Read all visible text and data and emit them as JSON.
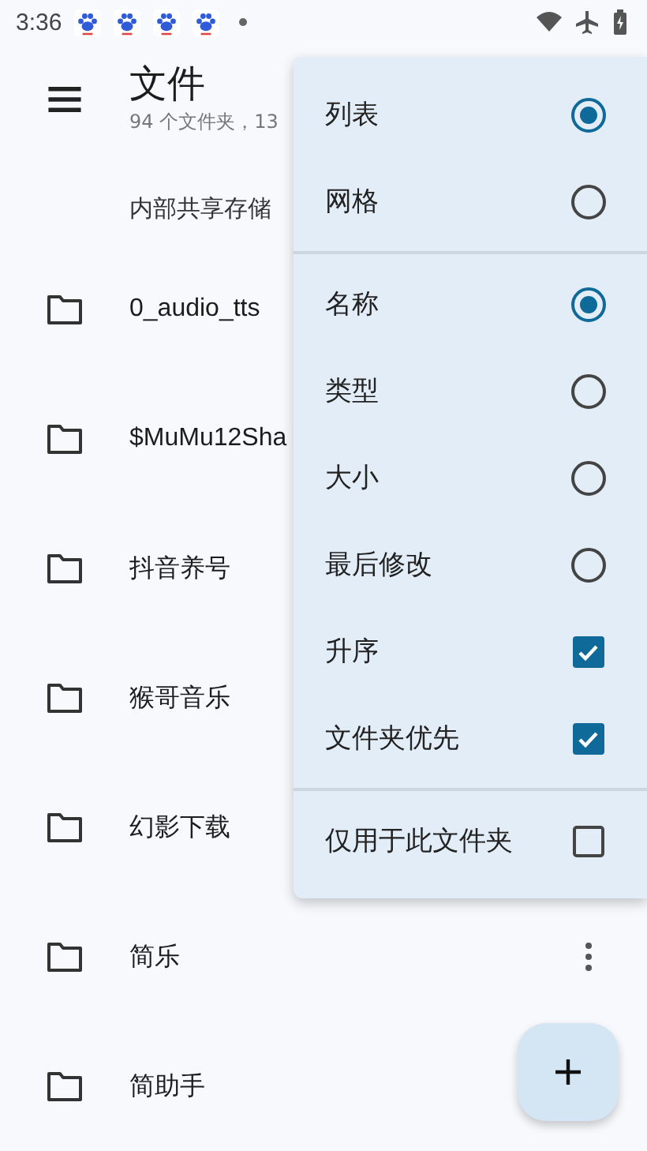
{
  "status_bar": {
    "time": "3:36",
    "notification_icons": [
      {
        "kind": "paw"
      },
      {
        "kind": "paw"
      },
      {
        "kind": "paw"
      },
      {
        "kind": "paw"
      }
    ]
  },
  "header": {
    "title": "文件",
    "subtitle": "94 个文件夹，13"
  },
  "breadcrumb": "内部共享存储",
  "folders": [
    {
      "name": "0_audio_tts"
    },
    {
      "name": "$MuMu12Sha"
    },
    {
      "name": "抖音养号"
    },
    {
      "name": "猴哥音乐"
    },
    {
      "name": "幻影下载"
    },
    {
      "name": "简乐",
      "more": true
    },
    {
      "name": "简助手"
    }
  ],
  "menu": {
    "groups": [
      {
        "items": [
          {
            "label": "列表",
            "kind": "radio",
            "selected": true
          },
          {
            "label": "网格",
            "kind": "radio",
            "selected": false
          }
        ]
      },
      {
        "items": [
          {
            "label": "名称",
            "kind": "radio",
            "selected": true
          },
          {
            "label": "类型",
            "kind": "radio",
            "selected": false
          },
          {
            "label": "大小",
            "kind": "radio",
            "selected": false
          },
          {
            "label": "最后修改",
            "kind": "radio",
            "selected": false
          },
          {
            "label": "升序",
            "kind": "checkbox",
            "checked": true
          },
          {
            "label": "文件夹优先",
            "kind": "checkbox",
            "checked": true
          }
        ]
      },
      {
        "items": [
          {
            "label": "仅用于此文件夹",
            "kind": "checkbox",
            "checked": false
          }
        ]
      }
    ]
  }
}
